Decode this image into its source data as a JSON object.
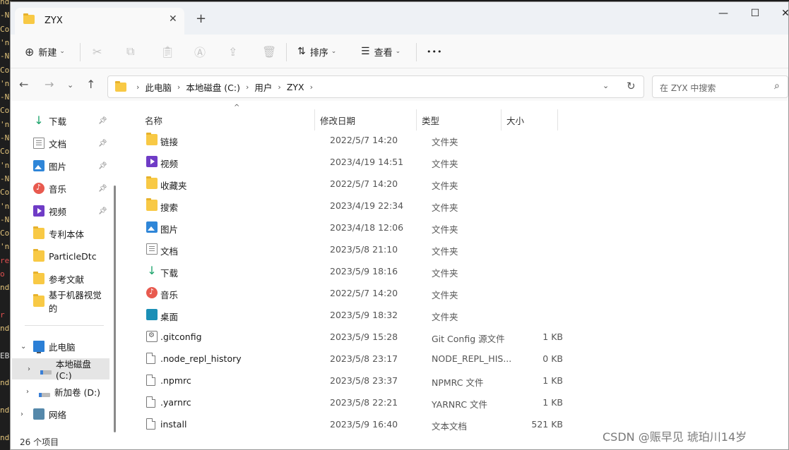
{
  "terminal": {
    "lines": [
      {
        "text": "nd:",
        "color": "#e0c27a"
      },
      {
        "text": "-NO",
        "color": "#e0c27a"
      },
      {
        "text": "Con",
        "color": "#e0c27a"
      },
      {
        "text": "'np",
        "color": "#e0c27a"
      },
      {
        "text": "-NO",
        "color": "#e0c27a"
      },
      {
        "text": "Con",
        "color": "#e0c27a"
      },
      {
        "text": "'np",
        "color": "#e0c27a"
      },
      {
        "text": "-NO",
        "color": "#e0c27a"
      },
      {
        "text": "Con",
        "color": "#e0c27a"
      },
      {
        "text": "'np",
        "color": "#e0c27a"
      },
      {
        "text": "-NO",
        "color": "#e0c27a"
      },
      {
        "text": "Con",
        "color": "#e0c27a"
      },
      {
        "text": "'np",
        "color": "#e0c27a"
      },
      {
        "text": "-NO",
        "color": "#e0c27a"
      },
      {
        "text": "Con",
        "color": "#e0c27a"
      },
      {
        "text": "'np",
        "color": "#e0c27a"
      },
      {
        "text": "-NO",
        "color": "#e0c27a"
      },
      {
        "text": "Con",
        "color": "#e0c27a"
      },
      {
        "text": "'np",
        "color": "#e0c27a"
      },
      {
        "text": "req",
        "color": "#e05050"
      },
      {
        "text": "o",
        "color": "#e05050"
      },
      {
        "text": "nd:",
        "color": "#e0c27a"
      },
      {
        "text": "",
        "color": "#e0c27a"
      },
      {
        "text": "r ",
        "color": "#e05050"
      },
      {
        "text": "nd:",
        "color": "#e0c27a"
      },
      {
        "text": "",
        "color": "#e0c27a"
      },
      {
        "text": "EB:",
        "color": "#dddddd"
      },
      {
        "text": "",
        "color": "#e0c27a"
      },
      {
        "text": "nd:",
        "color": "#e0c27a"
      },
      {
        "text": "",
        "color": "#e0c27a"
      },
      {
        "text": "nd:",
        "color": "#e0c27a"
      },
      {
        "text": "",
        "color": "#e0c27a"
      },
      {
        "text": "nd:",
        "color": "#e0c27a"
      }
    ]
  },
  "window": {
    "tab_title": "ZYX",
    "tab_close": "✕",
    "new_tab": "+",
    "minimize": "—",
    "maximize": "☐",
    "close": "✕"
  },
  "toolbar": {
    "new_label": "新建",
    "sort_label": "排序",
    "view_label": "查看",
    "more_label": "•••",
    "icons": [
      "cut-icon",
      "copy-icon",
      "paste-icon",
      "rename-icon",
      "share-icon",
      "delete-icon"
    ]
  },
  "address": {
    "crumbs": [
      "此电脑",
      "本地磁盘 (C:)",
      "用户",
      "ZYX"
    ],
    "search_placeholder": "在 ZYX 中搜索"
  },
  "sidebar": {
    "quick": [
      {
        "label": "下载",
        "icon": "download-icon",
        "pinned": true
      },
      {
        "label": "文档",
        "icon": "document-icon",
        "pinned": true
      },
      {
        "label": "图片",
        "icon": "pictures-icon",
        "pinned": true
      },
      {
        "label": "音乐",
        "icon": "music-icon",
        "pinned": true
      },
      {
        "label": "视频",
        "icon": "videos-icon",
        "pinned": true
      },
      {
        "label": "专利本体",
        "icon": "folder-icon",
        "pinned": false
      },
      {
        "label": "ParticleDtc",
        "icon": "folder-icon",
        "pinned": false
      },
      {
        "label": "参考文献",
        "icon": "folder-icon",
        "pinned": false
      },
      {
        "label": "基于机器视觉的",
        "icon": "folder-icon",
        "pinned": false
      }
    ],
    "tree": [
      {
        "label": "此电脑",
        "icon": "pc-icon",
        "expanded": true
      },
      {
        "label": "本地磁盘 (C:)",
        "icon": "drive-icon",
        "selected": true
      },
      {
        "label": "新加卷 (D:)",
        "icon": "drive-icon"
      },
      {
        "label": "网络",
        "icon": "network-icon"
      }
    ]
  },
  "columns": {
    "name": "名称",
    "date": "修改日期",
    "type": "类型",
    "size": "大小"
  },
  "files": [
    {
      "name": "链接",
      "date": "2022/5/7 14:20",
      "type": "文件夹",
      "size": "",
      "icon": "folder-icon"
    },
    {
      "name": "视频",
      "date": "2023/4/19 14:51",
      "type": "文件夹",
      "size": "",
      "icon": "videos-icon"
    },
    {
      "name": "收藏夹",
      "date": "2022/5/7 14:20",
      "type": "文件夹",
      "size": "",
      "icon": "folder-icon"
    },
    {
      "name": "搜索",
      "date": "2023/4/19 22:34",
      "type": "文件夹",
      "size": "",
      "icon": "folder-icon"
    },
    {
      "name": "图片",
      "date": "2023/4/18 12:06",
      "type": "文件夹",
      "size": "",
      "icon": "pictures-icon"
    },
    {
      "name": "文档",
      "date": "2023/5/8 21:10",
      "type": "文件夹",
      "size": "",
      "icon": "document-icon"
    },
    {
      "name": "下载",
      "date": "2023/5/9 18:16",
      "type": "文件夹",
      "size": "",
      "icon": "download-icon"
    },
    {
      "name": "音乐",
      "date": "2022/5/7 14:20",
      "type": "文件夹",
      "size": "",
      "icon": "music-icon"
    },
    {
      "name": "桌面",
      "date": "2023/5/9 18:32",
      "type": "文件夹",
      "size": "",
      "icon": "desktop-icon"
    },
    {
      "name": ".gitconfig",
      "date": "2023/5/9 15:28",
      "type": "Git Config 源文件",
      "size": "1 KB",
      "icon": "config-file-icon"
    },
    {
      "name": ".node_repl_history",
      "date": "2023/5/8 23:17",
      "type": "NODE_REPL_HIS...",
      "size": "0 KB",
      "icon": "file-icon"
    },
    {
      "name": ".npmrc",
      "date": "2023/5/8 23:37",
      "type": "NPMRC 文件",
      "size": "1 KB",
      "icon": "file-icon"
    },
    {
      "name": ".yarnrc",
      "date": "2023/5/8 22:21",
      "type": "YARNRC 文件",
      "size": "1 KB",
      "icon": "file-icon"
    },
    {
      "name": "install",
      "date": "2023/5/9 16:40",
      "type": "文本文档",
      "size": "521 KB",
      "icon": "text-file-icon"
    }
  ],
  "status": {
    "item_count": "26 个项目"
  },
  "watermark": "CSDN @赈早见 琥珀川14岁"
}
